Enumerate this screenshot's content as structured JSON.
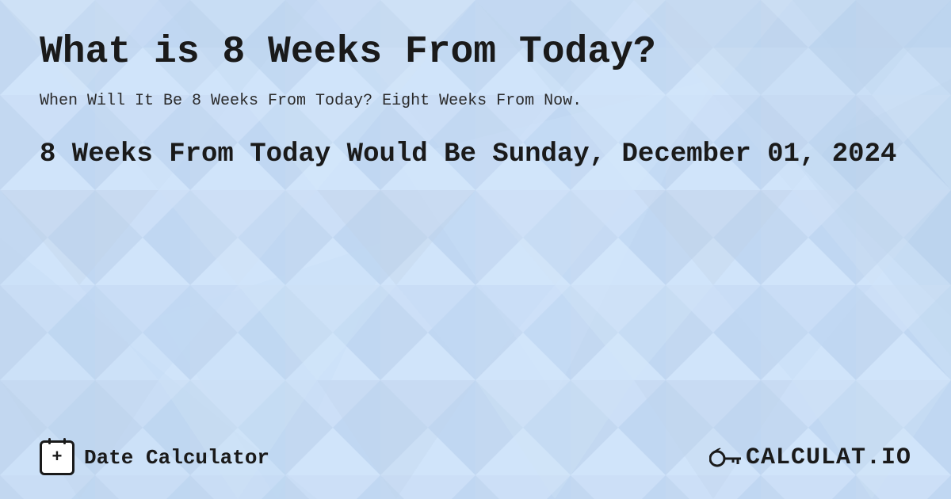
{
  "page": {
    "title": "What is 8 Weeks From Today?",
    "subtitle": "When Will It Be 8 Weeks From Today? Eight Weeks From Now.",
    "result": "8 Weeks From Today Would Be Sunday, December 01, 2024",
    "footer": {
      "date_calculator_label": "Date Calculator",
      "logo_text": "CALCULAT.IO"
    },
    "background_color": "#c8ddf4"
  }
}
